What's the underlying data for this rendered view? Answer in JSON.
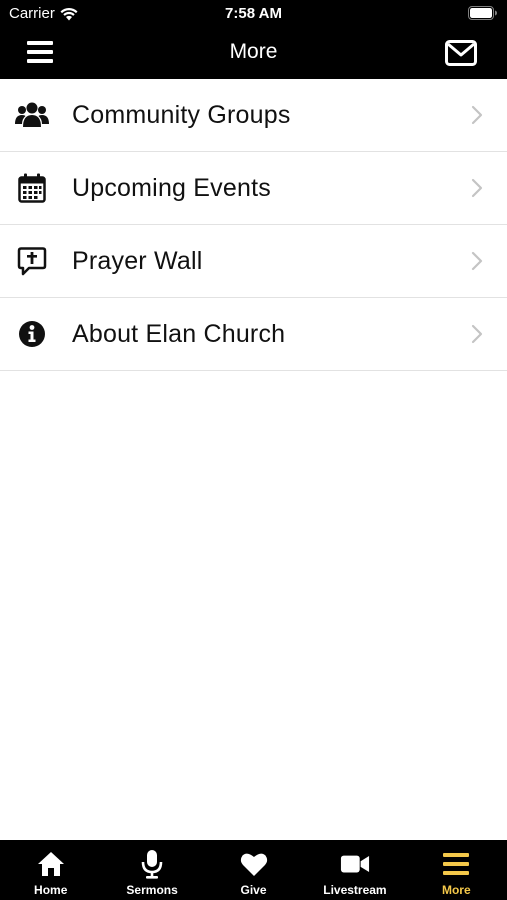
{
  "status_bar": {
    "carrier": "Carrier",
    "time": "7:58 AM"
  },
  "nav": {
    "title": "More",
    "menu_icon": "hamburger-icon",
    "mail_icon": "envelope-icon"
  },
  "menu": {
    "items": [
      {
        "label": "Community Groups",
        "icon": "users-icon"
      },
      {
        "label": "Upcoming Events",
        "icon": "calendar-icon"
      },
      {
        "label": "Prayer Wall",
        "icon": "prayer-bubble-icon"
      },
      {
        "label": "About Elan Church",
        "icon": "info-icon"
      }
    ]
  },
  "tabs": [
    {
      "label": "Home",
      "icon": "home-icon",
      "active": false
    },
    {
      "label": "Sermons",
      "icon": "microphone-icon",
      "active": false
    },
    {
      "label": "Give",
      "icon": "heart-icon",
      "active": false
    },
    {
      "label": "Livestream",
      "icon": "video-camera-icon",
      "active": false
    },
    {
      "label": "More",
      "icon": "hamburger-icon",
      "active": true
    }
  ],
  "colors": {
    "bar_background": "#000000",
    "active_tab": "#f4c84a",
    "divider": "#e2e2e2",
    "chevron": "#c4c4c4"
  }
}
